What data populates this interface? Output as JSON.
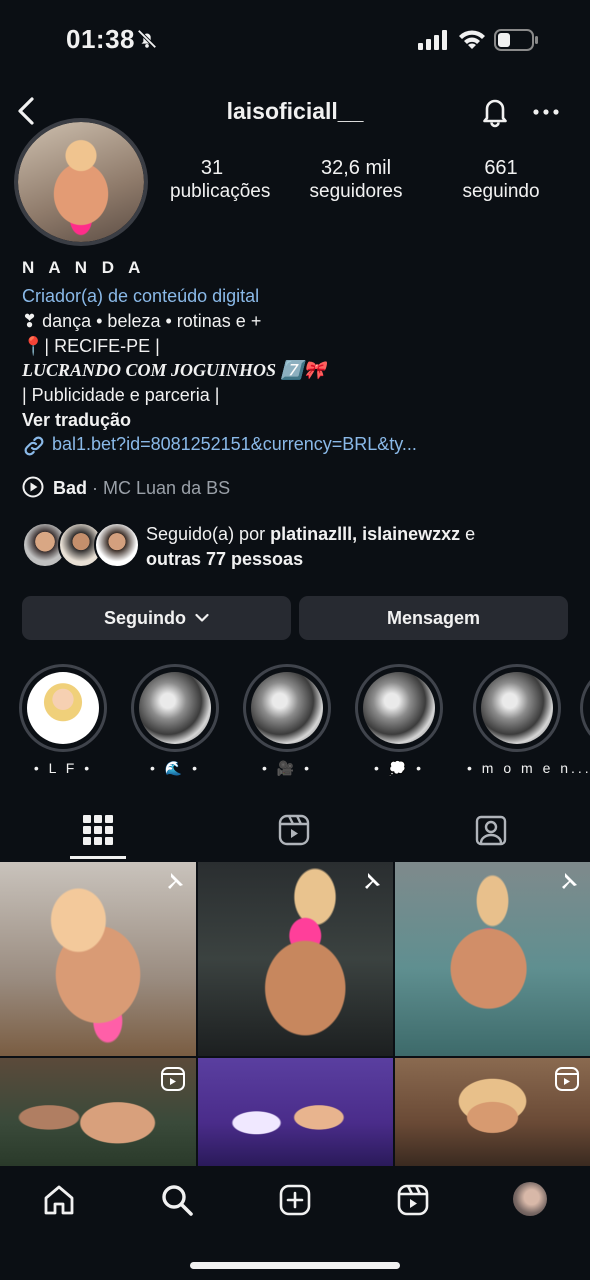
{
  "status_bar": {
    "time": "01:38"
  },
  "header": {
    "username": "laisoficiall__"
  },
  "stats": [
    {
      "value": "31",
      "label": "publicações"
    },
    {
      "value": "32,6 mil",
      "label": "seguidores"
    },
    {
      "value": "661",
      "label": "seguindo"
    }
  ],
  "profile": {
    "name": "N A N D A",
    "category": "Criador(a) de conteúdo digital",
    "bio_lines": [
      "❣ dança • beleza • rotinas e +",
      "📍| RECIFE-PE |",
      "LUCRANDO COM JOGUINHOS 7️⃣🎀",
      "| Publicidade e parceria |"
    ],
    "translate_label": "Ver tradução",
    "link": "bal1.bet?id=8081252151&currency=BRL&ty...",
    "music_title": "Bad",
    "music_artist": " · MC Luan da BS"
  },
  "followed_by": {
    "prefix": "Seguido(a) por ",
    "names": "platinazlll, islainewzxz",
    "middle": " e",
    "others": "outras 77 pessoas"
  },
  "buttons": {
    "following": "Seguindo",
    "message": "Mensagem"
  },
  "highlights": [
    {
      "label": "• L F •"
    },
    {
      "label": "• 🌊 •"
    },
    {
      "label": "• 🎥 •"
    },
    {
      "label": "• 💭 •"
    },
    {
      "label": "• m o m e n..."
    }
  ],
  "colors": {
    "background": "#0b0f14",
    "link": "#8ab9e8",
    "button": "#272a31"
  }
}
